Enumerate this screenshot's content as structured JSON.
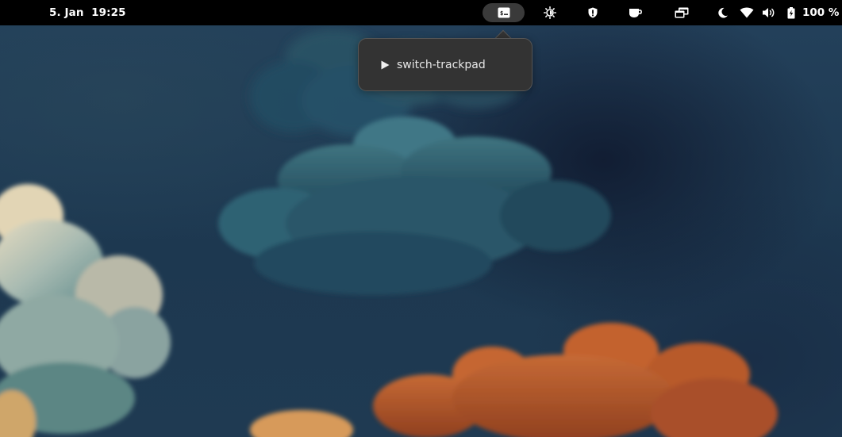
{
  "topbar": {
    "datetime": "5. Jan  19:25",
    "indicators": [
      {
        "icon": "terminal-icon",
        "active": true
      },
      {
        "icon": "brightness-icon"
      },
      {
        "icon": "shield-icon"
      },
      {
        "icon": "coffee-cup-icon"
      },
      {
        "icon": "windows-icon"
      },
      {
        "icon": "night-light-moon-icon"
      },
      {
        "icon": "wifi-icon"
      },
      {
        "icon": "volume-icon"
      },
      {
        "icon": "battery-icon"
      }
    ],
    "battery_percent": "100 %"
  },
  "popup": {
    "items": [
      {
        "label": "switch-trackpad",
        "icon": "play-icon"
      }
    ]
  },
  "colors": {
    "topbar_bg": "#000000",
    "popup_bg": "#333333",
    "active_indicator_bg": "#3a3a3a"
  }
}
